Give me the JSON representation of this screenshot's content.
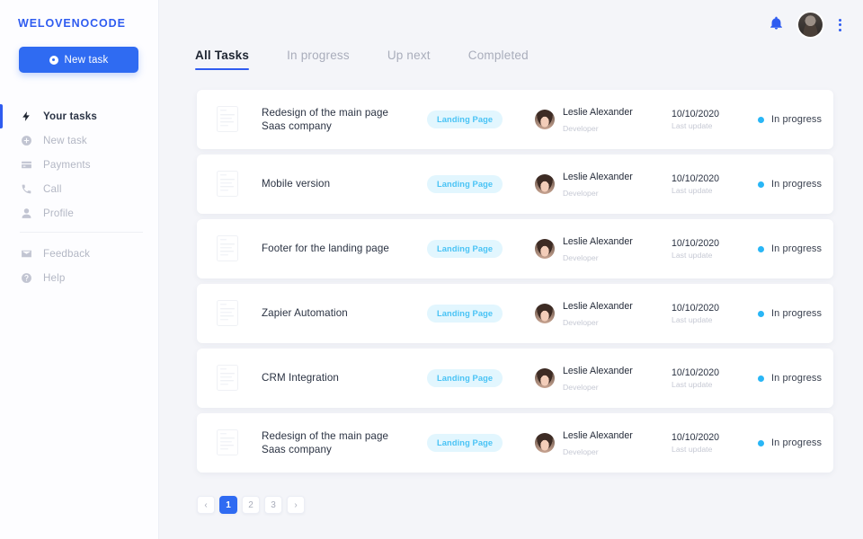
{
  "sidebar": {
    "logo": "WELOVENOCODE",
    "new_task_button": "New task",
    "items": [
      {
        "label": "Your tasks",
        "icon": "bolt-icon",
        "active": true
      },
      {
        "label": "New task",
        "icon": "plus-circle-icon",
        "active": false
      },
      {
        "label": "Payments",
        "icon": "credit-card-icon",
        "active": false
      },
      {
        "label": "Call",
        "icon": "phone-icon",
        "active": false
      },
      {
        "label": "Profile",
        "icon": "person-icon",
        "active": false
      }
    ],
    "footer_items": [
      {
        "label": "Feedback",
        "icon": "envelope-icon"
      },
      {
        "label": "Help",
        "icon": "help-circle-icon"
      }
    ]
  },
  "header": {
    "notifications_icon": "bell-icon",
    "avatar": "user-avatar",
    "more_icon": "kebab-menu-icon"
  },
  "tabs": [
    {
      "label": "All Tasks",
      "active": true
    },
    {
      "label": "In progress",
      "active": false
    },
    {
      "label": "Up next",
      "active": false
    },
    {
      "label": "Completed",
      "active": false
    }
  ],
  "colors": {
    "brand_blue": "#2f5cf0",
    "button_blue": "#2f6bf2",
    "badge_bg": "#e2f6fe",
    "badge_text": "#49c3f5",
    "status_dot": "#29b6f6",
    "page_bg": "#f4f5f9"
  },
  "tasks": [
    {
      "title_line1": "Redesign of the main page",
      "title_line2": "Saas company",
      "tag": "Landing Page",
      "assignee_name": "Leslie Alexander",
      "assignee_role": "Developer",
      "date": "10/10/2020",
      "date_sub": "Last update",
      "status": "In progress"
    },
    {
      "title_line1": "Mobile version",
      "title_line2": "",
      "tag": "Landing Page",
      "assignee_name": "Leslie Alexander",
      "assignee_role": "Developer",
      "date": "10/10/2020",
      "date_sub": "Last update",
      "status": "In progress"
    },
    {
      "title_line1": "Footer for the landing page",
      "title_line2": "",
      "tag": "Landing Page",
      "assignee_name": "Leslie Alexander",
      "assignee_role": "Developer",
      "date": "10/10/2020",
      "date_sub": "Last update",
      "status": "In progress"
    },
    {
      "title_line1": "Zapier Automation",
      "title_line2": "",
      "tag": "Landing Page",
      "assignee_name": "Leslie Alexander",
      "assignee_role": "Developer",
      "date": "10/10/2020",
      "date_sub": "Last update",
      "status": "In progress"
    },
    {
      "title_line1": "CRM Integration",
      "title_line2": "",
      "tag": "Landing Page",
      "assignee_name": "Leslie Alexander",
      "assignee_role": "Developer",
      "date": "10/10/2020",
      "date_sub": "Last update",
      "status": "In progress"
    },
    {
      "title_line1": "Redesign of the main page",
      "title_line2": "Saas company",
      "tag": "Landing Page",
      "assignee_name": "Leslie Alexander",
      "assignee_role": "Developer",
      "date": "10/10/2020",
      "date_sub": "Last update",
      "status": "In progress"
    }
  ],
  "pagination": {
    "prev": "‹",
    "next": "›",
    "pages": [
      "1",
      "2",
      "3"
    ],
    "current": "1"
  }
}
